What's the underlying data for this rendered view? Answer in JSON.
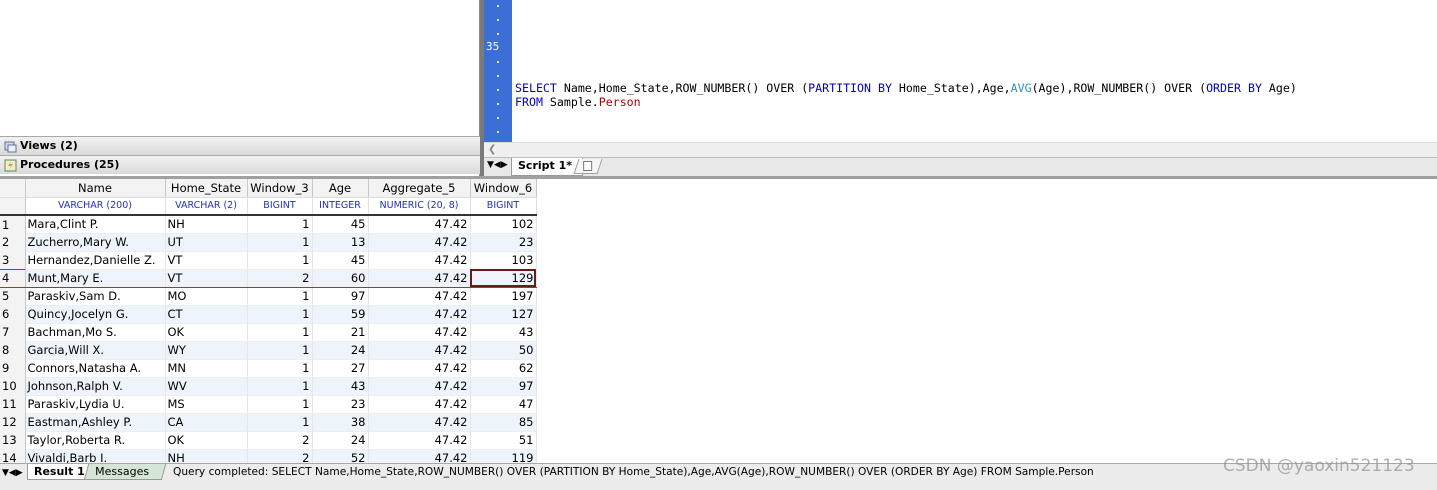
{
  "object_browser": {
    "items": [
      {
        "label": "Views (2)",
        "icon": "views-icon"
      },
      {
        "label": "Procedures (25)",
        "icon": "procedures-icon"
      }
    ]
  },
  "editor": {
    "gutter_line_number": "35",
    "sql_line1": {
      "t1": "SELECT",
      "t2": " Name,Home_State,ROW_NUMBER() OVER (",
      "t3": "PARTITION BY",
      "t4": " Home_State),Age,",
      "t5": "AVG",
      "t6": "(Age),ROW_NUMBER() OVER (",
      "t7": "ORDER BY",
      "t8": " Age)"
    },
    "sql_line2": {
      "t1": "FROM",
      "t2": " Sample.",
      "t3": "Person"
    }
  },
  "script_tab": {
    "label": "Script 1*"
  },
  "results": {
    "columns": [
      {
        "name": "Name",
        "type": "VARCHAR (200)"
      },
      {
        "name": "Home_State",
        "type": "VARCHAR (2)"
      },
      {
        "name": "Window_3",
        "type": "BIGINT"
      },
      {
        "name": "Age",
        "type": "INTEGER"
      },
      {
        "name": "Aggregate_5",
        "type": "NUMERIC (20, 8)"
      },
      {
        "name": "Window_6",
        "type": "BIGINT"
      }
    ],
    "rows": [
      [
        "1",
        "Mara,Clint P.",
        "NH",
        "1",
        "45",
        "47.42",
        "102"
      ],
      [
        "2",
        "Zucherro,Mary W.",
        "UT",
        "1",
        "13",
        "47.42",
        "23"
      ],
      [
        "3",
        "Hernandez,Danielle Z.",
        "VT",
        "1",
        "45",
        "47.42",
        "103"
      ],
      [
        "4",
        "Munt,Mary E.",
        "VT",
        "2",
        "60",
        "47.42",
        "129"
      ],
      [
        "5",
        "Paraskiv,Sam D.",
        "MO",
        "1",
        "97",
        "47.42",
        "197"
      ],
      [
        "6",
        "Quincy,Jocelyn G.",
        "CT",
        "1",
        "59",
        "47.42",
        "127"
      ],
      [
        "7",
        "Bachman,Mo S.",
        "OK",
        "1",
        "21",
        "47.42",
        "43"
      ],
      [
        "8",
        "Garcia,Will X.",
        "WY",
        "1",
        "24",
        "47.42",
        "50"
      ],
      [
        "9",
        "Connors,Natasha A.",
        "MN",
        "1",
        "27",
        "47.42",
        "62"
      ],
      [
        "10",
        "Johnson,Ralph V.",
        "WV",
        "1",
        "43",
        "47.42",
        "97"
      ],
      [
        "11",
        "Paraskiv,Lydia U.",
        "MS",
        "1",
        "23",
        "47.42",
        "47"
      ],
      [
        "12",
        "Eastman,Ashley P.",
        "CA",
        "1",
        "38",
        "47.42",
        "85"
      ],
      [
        "13",
        "Taylor,Roberta R.",
        "OK",
        "2",
        "24",
        "47.42",
        "51"
      ],
      [
        "14",
        "Vivaldi,Barb I.",
        "NH",
        "2",
        "52",
        "47.42",
        "119"
      ]
    ],
    "selected_row": "4"
  },
  "bottom_tabs": [
    {
      "label": "Result 1"
    },
    {
      "label": "Messages"
    }
  ],
  "status": {
    "text": "Query completed: SELECT Name,Home_State,ROW_NUMBER() OVER (PARTITION BY Home_State),Age,AVG(Age),ROW_NUMBER() OVER (ORDER BY Age)  FROM Sample.Person"
  },
  "watermark": "CSDN @yaoxin521123",
  "colors": {
    "gutter": "#3b6fd6",
    "keyword": "#0000cc",
    "function": "#2a8fd6",
    "table_name": "#b00000",
    "type_text": "#2030c8",
    "selection_border": "#b03030"
  }
}
